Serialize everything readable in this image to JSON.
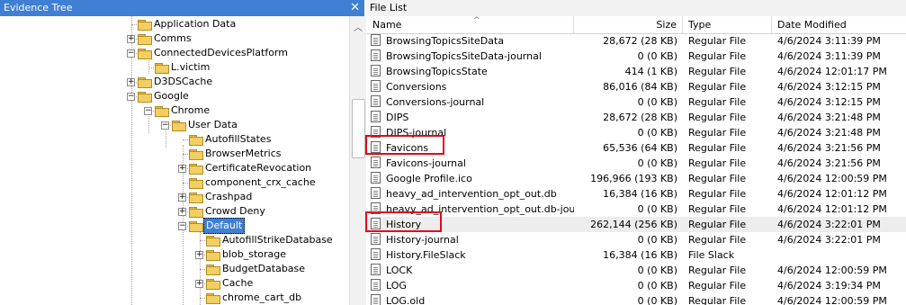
{
  "left_pane": {
    "title": "Evidence  Tree",
    "close_label": "✕",
    "scroll_up_label": "︿",
    "tree": [
      {
        "label": "Application Data",
        "expander": ""
      },
      {
        "label": "Comms",
        "expander": "+"
      },
      {
        "label": "ConnectedDevicesPlatform",
        "expander": "−"
      },
      {
        "label": "L.victim",
        "expander": ""
      },
      {
        "label": "D3DSCache",
        "expander": "+"
      },
      {
        "label": "Google",
        "expander": "−"
      },
      {
        "label": "Chrome",
        "expander": "−"
      },
      {
        "label": "User Data",
        "expander": "−"
      },
      {
        "label": "AutofillStates",
        "expander": ""
      },
      {
        "label": "BrowserMetrics",
        "expander": ""
      },
      {
        "label": "CertificateRevocation",
        "expander": "+"
      },
      {
        "label": "component_crx_cache",
        "expander": ""
      },
      {
        "label": "Crashpad",
        "expander": "+"
      },
      {
        "label": "Crowd Deny",
        "expander": "+"
      },
      {
        "label": "Default",
        "expander": "−"
      },
      {
        "label": "AutofillStrikeDatabase",
        "expander": ""
      },
      {
        "label": "blob_storage",
        "expander": "+"
      },
      {
        "label": "BudgetDatabase",
        "expander": ""
      },
      {
        "label": "Cache",
        "expander": "+"
      },
      {
        "label": "chrome_cart_db",
        "expander": ""
      }
    ]
  },
  "right_pane": {
    "title": "File List",
    "columns": {
      "name": "Name",
      "size": "Size",
      "type": "Type",
      "modified": "Date Modified"
    },
    "sort_indicator": "^",
    "files": [
      {
        "name": "BrowsingTopicsSiteData",
        "size": "28,672 (28 KB)",
        "type": "Regular File",
        "modified": "4/6/2024 3:11:39 PM"
      },
      {
        "name": "BrowsingTopicsSiteData-journal",
        "size": "0 (0 KB)",
        "type": "Regular File",
        "modified": "4/6/2024 3:11:39 PM"
      },
      {
        "name": "BrowsingTopicsState",
        "size": "414 (1 KB)",
        "type": "Regular File",
        "modified": "4/6/2024 12:01:17 PM"
      },
      {
        "name": "Conversions",
        "size": "86,016 (84 KB)",
        "type": "Regular File",
        "modified": "4/6/2024 3:12:15 PM"
      },
      {
        "name": "Conversions-journal",
        "size": "0 (0 KB)",
        "type": "Regular File",
        "modified": "4/6/2024 3:12:15 PM"
      },
      {
        "name": "DIPS",
        "size": "28,672 (28 KB)",
        "type": "Regular File",
        "modified": "4/6/2024 3:21:48 PM"
      },
      {
        "name": "DIPS-journal",
        "size": "0 (0 KB)",
        "type": "Regular File",
        "modified": "4/6/2024 3:21:48 PM"
      },
      {
        "name": "Favicons",
        "size": "65,536 (64 KB)",
        "type": "Regular File",
        "modified": "4/6/2024 3:21:56 PM"
      },
      {
        "name": "Favicons-journal",
        "size": "0 (0 KB)",
        "type": "Regular File",
        "modified": "4/6/2024 3:21:56 PM"
      },
      {
        "name": "Google Profile.ico",
        "size": "196,966 (193 KB)",
        "type": "Regular File",
        "modified": "4/6/2024 12:00:59 PM"
      },
      {
        "name": "heavy_ad_intervention_opt_out.db",
        "size": "16,384 (16 KB)",
        "type": "Regular File",
        "modified": "4/6/2024 12:01:12 PM"
      },
      {
        "name": "heavy_ad_intervention_opt_out.db-journal",
        "size": "0 (0 KB)",
        "type": "Regular File",
        "modified": "4/6/2024 12:01:12 PM"
      },
      {
        "name": "History",
        "size": "262,144 (256 KB)",
        "type": "Regular File",
        "modified": "4/6/2024 3:22:01 PM"
      },
      {
        "name": "History-journal",
        "size": "0 (0 KB)",
        "type": "Regular File",
        "modified": "4/6/2024 3:22:01 PM"
      },
      {
        "name": "History.FileSlack",
        "size": "16,384 (16 KB)",
        "type": "File Slack",
        "modified": ""
      },
      {
        "name": "LOCK",
        "size": "0 (0 KB)",
        "type": "Regular File",
        "modified": "4/6/2024 12:00:59 PM"
      },
      {
        "name": "LOG",
        "size": "0 (0 KB)",
        "type": "Regular File",
        "modified": "4/6/2024 3:19:34 PM"
      },
      {
        "name": "LOG.old",
        "size": "0 (0 KB)",
        "type": "Regular File",
        "modified": "4/6/2024 12:00:59 PM"
      }
    ]
  },
  "colors": {
    "selection_blue": "#3f7fd4",
    "highlight_red": "#e3071d",
    "folder_yellow": "#f2cf62"
  }
}
